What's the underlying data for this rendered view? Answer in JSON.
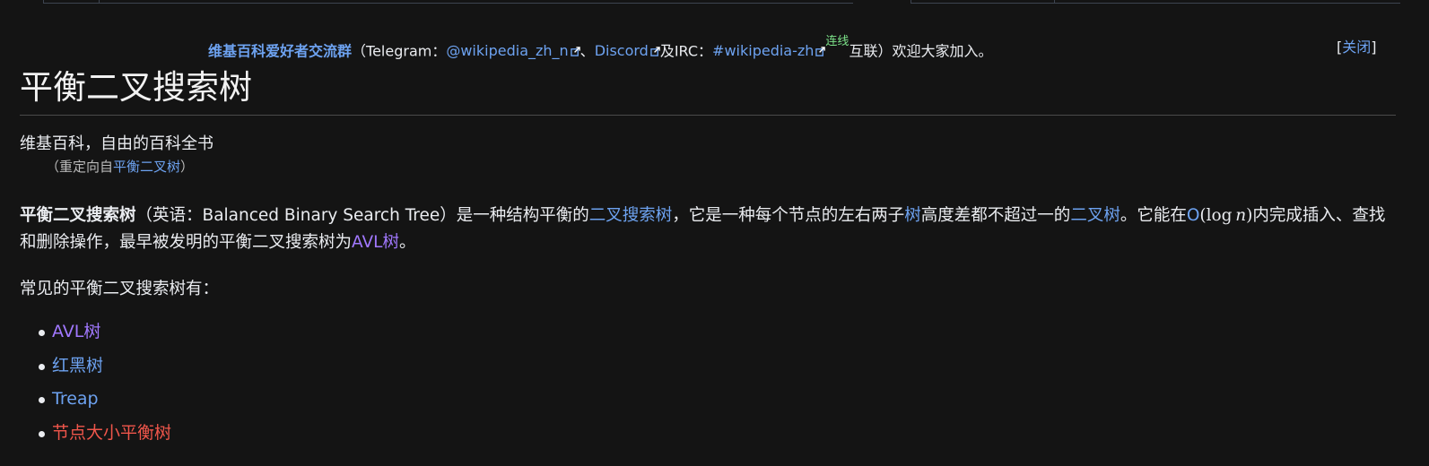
{
  "sitenotice": {
    "group_name": "维基百科爱好者交流群",
    "open_paren": "（Telegram：",
    "telegram": "@wikipedia_zh_n",
    "sep1": "、",
    "discord": "Discord",
    "and_irc": "及IRC：",
    "irc": "#wikipedia-zh",
    "interlinked": "连线",
    "tail": "互联）欢迎大家加入。",
    "dismiss_open": "[",
    "dismiss_label": "关闭",
    "dismiss_close": "]"
  },
  "page": {
    "title": "平衡二叉搜索树",
    "tagline": "维基百科，自由的百科全书",
    "redirect_prefix": "（重定向自",
    "redirect_link": "平衡二叉树",
    "redirect_suffix": "）"
  },
  "intro": {
    "term": "平衡二叉搜索树",
    "english_prefix": "（英语：Balanced Binary Search Tree）是一种结构平衡的",
    "link_bst": "二叉搜索树",
    "text2": "，它是一种每个节点的左右两子",
    "link_tree": "树",
    "text3": "高度差都不超过一的",
    "link_binary_tree": "二叉树",
    "text4": "。它能在",
    "link_bigo": "O",
    "math_open": "(",
    "math_log": "log",
    "math_n": "n",
    "math_close": ")",
    "text5": "内完成插入、查找和删除操作，最早被发明的平衡二叉搜索树为",
    "link_avl": "AVL树",
    "text6": "。"
  },
  "common_heading": "常见的平衡二叉搜索树有：",
  "list": [
    {
      "label": "AVL树",
      "style": "visited"
    },
    {
      "label": "红黑树",
      "style": "link"
    },
    {
      "label": "Treap",
      "style": "link"
    },
    {
      "label": "节点大小平衡树",
      "style": "new"
    }
  ],
  "colors": {
    "background": "#141414",
    "text": "#eaecf0",
    "link": "#6da2f0",
    "visited": "#a178ff",
    "new_page": "#f0564b",
    "green": "#7de38a"
  }
}
